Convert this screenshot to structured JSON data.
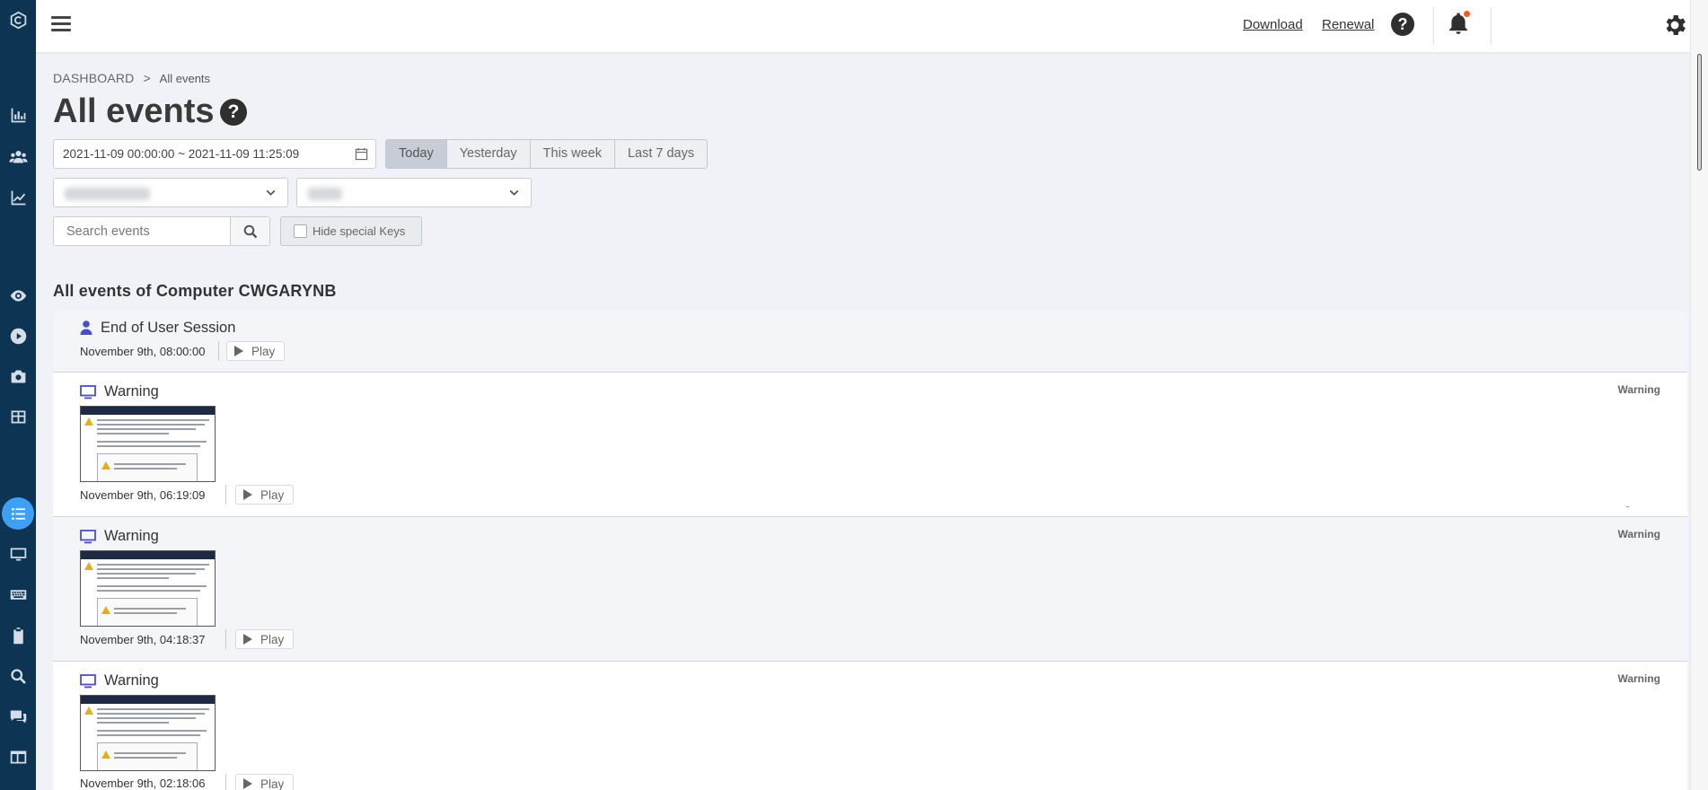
{
  "header": {
    "download_label": "Download",
    "renewal_label": "Renewal",
    "help_label": "?"
  },
  "breadcrumb": {
    "root": "DASHBOARD",
    "separator": ">",
    "current": "All events"
  },
  "page": {
    "title": "All events",
    "help_label": "?",
    "section_title": "All events of Computer CWGARYNB"
  },
  "filters": {
    "date_range": "2021-11-09 00:00:00 ~ 2021-11-09 11:25:09",
    "ranges": [
      {
        "label": "Today",
        "active": true
      },
      {
        "label": "Yesterday",
        "active": false
      },
      {
        "label": "This week",
        "active": false
      },
      {
        "label": "Last 7 days",
        "active": false
      }
    ],
    "search_placeholder": "Search events",
    "hide_special_keys_label": "Hide special Keys"
  },
  "events": [
    {
      "type": "user",
      "title": "End of User Session",
      "time": "November 9th, 08:00:00",
      "play_label": "Play",
      "badge": ""
    },
    {
      "type": "computer",
      "title": "Warning",
      "time": "November 9th, 06:19:09",
      "play_label": "Play",
      "badge": "Warning"
    },
    {
      "type": "computer",
      "title": "Warning",
      "time": "November 9th, 04:18:37",
      "play_label": "Play",
      "badge": "Warning"
    },
    {
      "type": "computer",
      "title": "Warning",
      "time": "November 9th, 02:18:06",
      "play_label": "Play",
      "badge": "Warning"
    }
  ],
  "colors": {
    "sidebar_bg": "#0d3452",
    "active_accent": "#3da0f5",
    "notification_dot": "#f05a28",
    "event_icon": "#4a4fc7"
  }
}
